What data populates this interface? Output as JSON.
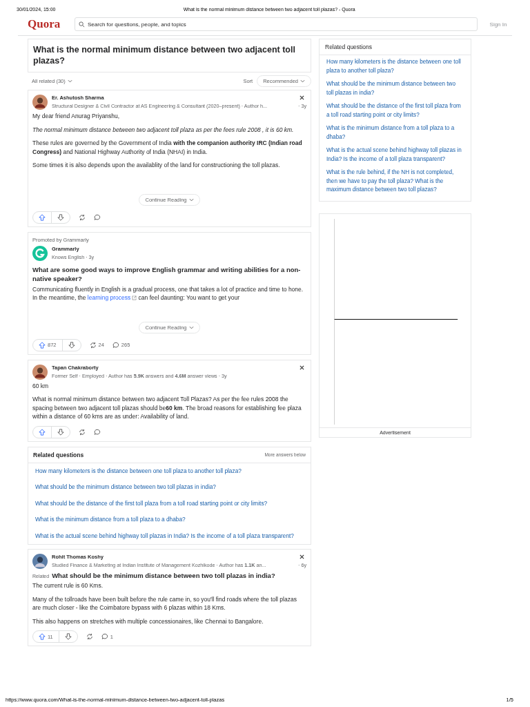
{
  "print_header": {
    "date": "30/01/2024, 15:00",
    "title": "What is the normal minimum distance between two adjacent toll plazas? - Quora"
  },
  "header": {
    "logo": "Quora",
    "search": {
      "placeholder": "Search for questions, people, and topics"
    },
    "sign_in": "Sign In"
  },
  "question": {
    "title": "What is the normal minimum distance between two adjacent toll plazas?"
  },
  "filter": {
    "all_related": "All related (30)",
    "sort_label": "Sort",
    "sort_value": "Recommended"
  },
  "answers": [
    {
      "kind": "answer",
      "author": "Er. Ashutosh Sharma",
      "credential": "Structural Designer & Civil Contractor at AS Engineering & Consultant (2020–present) · Author h...",
      "time": "· 3y",
      "paragraphs": [
        {
          "kind": "plain",
          "text": "My dear friend Anurag Priyanshu,"
        },
        {
          "kind": "italic",
          "text": "The normal minimum distance between two adjacent toll plaza as per the fees rule 2008 , it is 60 km."
        },
        {
          "kind": "plain",
          "text": "These rules are governed by the Government of India **with the companion authority IRC (Indian road Congress)** and National Highway Authority of India (NHAI) in India."
        },
        {
          "kind": "plain",
          "text": "Some times it is also depends upon the availablity of the land for constructioning the toll plazas."
        }
      ],
      "continue_reading": "Continue Reading"
    },
    {
      "kind": "promoted",
      "promoted_by": "Promoted by Grammarly",
      "author": "Grammarly",
      "credential": "Knows English · 3y",
      "headline": "What are some good ways to improve English grammar and writing abilities for a non-native speaker?",
      "paragraphs": [
        {
          "kind": "link",
          "before": "Communicating fluently in English is a gradual process, one that takes a lot of practice and time to hone. In the meantime, the ",
          "link": "learning process",
          "after": " can feel daunting: You want to get your"
        }
      ],
      "continue_reading": "Continue Reading",
      "actions": {
        "upvotes": "872",
        "shares": "24",
        "comments": "265"
      }
    },
    {
      "kind": "answer",
      "author": "Tapan Chakraborty",
      "credential": "Former Self · Employed · Author has **5.9K** answers and **4.6M** answer views · 3y",
      "paragraphs": [
        {
          "kind": "plain",
          "text": "60 km"
        },
        {
          "kind": "plain",
          "text": "What is normal minimum distance between two adjacent Toll Plazas? As per the fee rules 2008 the spacing between two adjacent toll plazas should be**60 km**. The broad reasons for establishing fee plaza within a distance of 60 kms are as under: Availability of land."
        }
      ]
    }
  ],
  "related_inline": {
    "title": "Related questions",
    "note": "More answers below",
    "items": [
      "How many kilometers is the distance between one toll plaza to another toll plaza?",
      "What should be the minimum distance between two toll plazas in india?",
      "What should be the distance of the first toll plaza from a toll road starting point or city limits?",
      "What is the minimum distance from a toll plaza to a dhaba?",
      "What is the actual scene behind highway toll plazas in India? Is the income of a toll plaza transparent?"
    ]
  },
  "last_answer": {
    "author": "Rohit Thomas Koshy",
    "credential": "Studied Finance & Marketing at Indian Institute of Management Kozhikode · Author has **1.1K** an...",
    "time": "· 6y",
    "related_tag": "Related",
    "related_question": "What should be the minimum distance between two toll plazas in india?",
    "paragraphs": [
      {
        "text": "The current rule is 60 Kms."
      },
      {
        "text": "Many of the tollroads have been built before the rule came in, so you'll find roads where the toll plazas are much closer - like the Coimbatore bypass with 6 plazas within 18 Kms."
      },
      {
        "text": "This also happens on stretches with multiple concessionaires, like Chennai to Bangalore."
      }
    ],
    "actions": {
      "upvotes": "11",
      "comments": "1"
    }
  },
  "sidebar": {
    "title": "Related questions",
    "items": [
      "How many kilometers is the distance between one toll plaza to another toll plaza?",
      "What should be the minimum distance between two toll plazas in india?",
      "What should be the distance of the first toll plaza from a toll road starting point or city limits?",
      "What is the minimum distance from a toll plaza to a dhaba?",
      "What is the actual scene behind highway toll plazas in India? Is the income of a toll plaza transparent?",
      "What is the rule behind, if the NH is not completed, then we have to pay the toll plaza? What is the maximum distance between two toll plazas?"
    ],
    "ad_label": "Advertisement"
  },
  "footer": {
    "url": "https://www.quora.com/What-is-the-normal-minimum-distance-between-two-adjacent-toll-plazas",
    "page": "1/5"
  }
}
